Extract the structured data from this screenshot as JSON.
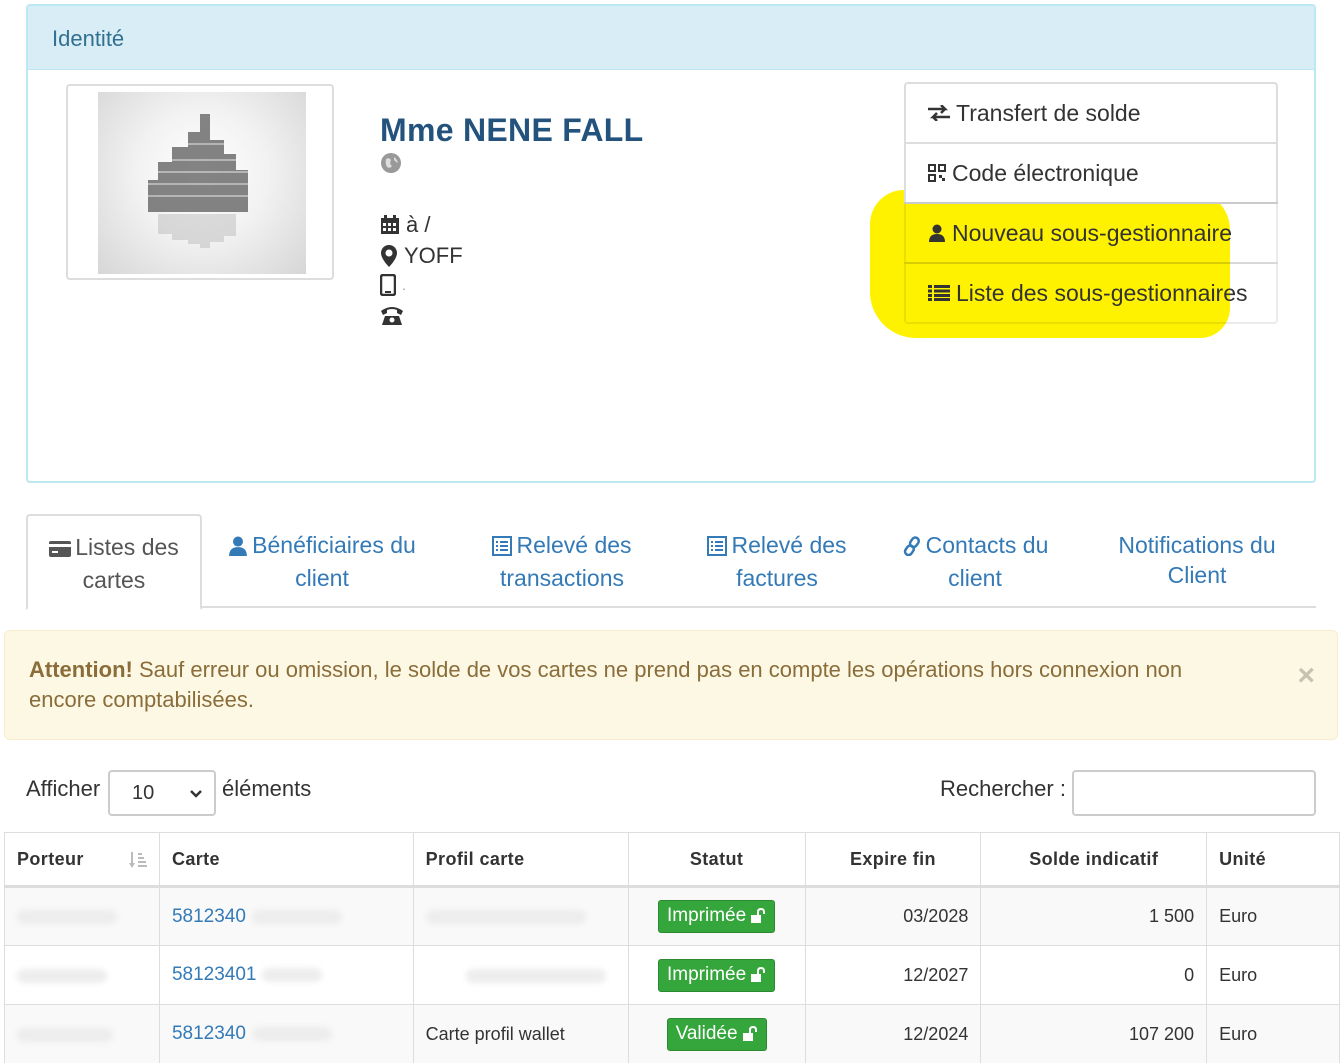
{
  "panel": {
    "title": "Identité",
    "client_name": "Mme NENE FALL",
    "date_line": "à /",
    "location": "YOFF",
    "mobile": "."
  },
  "actions": [
    {
      "label": "Transfert de solde",
      "icon": "exchange-icon"
    },
    {
      "label": "Code électronique",
      "icon": "qrcode-icon"
    },
    {
      "label": "Nouveau sous-gestionnaire",
      "icon": "user-icon"
    },
    {
      "label": "Liste des sous-gestionnaires",
      "icon": "list-icon"
    }
  ],
  "highlight_color": "#fff200",
  "tabs": [
    {
      "line1": "Listes des",
      "line2": "cartes",
      "icon": "credit-card-icon",
      "active": true
    },
    {
      "line1": "Bénéficiaires du",
      "line2": "client",
      "icon": "user-icon"
    },
    {
      "line1": "Relevé des",
      "line2": "transactions",
      "icon": "list-alt-icon"
    },
    {
      "line1": "Relevé des",
      "line2": "factures",
      "icon": "list-alt-icon"
    },
    {
      "line1": "Contacts du",
      "line2": "client",
      "icon": "link-icon"
    },
    {
      "line1": "Notifications du",
      "line2": "Client",
      "icon": ""
    }
  ],
  "alert": {
    "strong": "Attention!",
    "text": " Sauf erreur ou omission, le solde de vos cartes ne prend pas en compte les opérations hors connexion non encore comptabilisées.",
    "close": "×"
  },
  "controls": {
    "show_label": "Afficher",
    "page_length": "10",
    "show_suffix": "éléments",
    "search_label": "Rechercher :"
  },
  "table": {
    "headers": [
      "Porteur",
      "Carte",
      "Profil carte",
      "Statut",
      "Expire fin",
      "Solde indicatif",
      "Unité"
    ],
    "rows": [
      {
        "carte": "5812340",
        "profil": "",
        "statut": "Imprimée",
        "expire": "03/2028",
        "solde": "1 500",
        "unite": "Euro"
      },
      {
        "carte": "58123401",
        "profil": "",
        "statut": "Imprimée",
        "expire": "12/2027",
        "solde": "0",
        "unite": "Euro"
      },
      {
        "carte": "5812340",
        "profil": "Carte profil wallet",
        "statut": "Validée",
        "expire": "12/2024",
        "solde": "107 200",
        "unite": "Euro"
      }
    ]
  },
  "colors": {
    "panel_heading_bg": "#d9edf7",
    "panel_heading_text": "#31708f",
    "link": "#337ab7",
    "status_green": "#35a63c",
    "alert_bg": "#fcf8e3",
    "alert_text": "#8a6d3b"
  }
}
